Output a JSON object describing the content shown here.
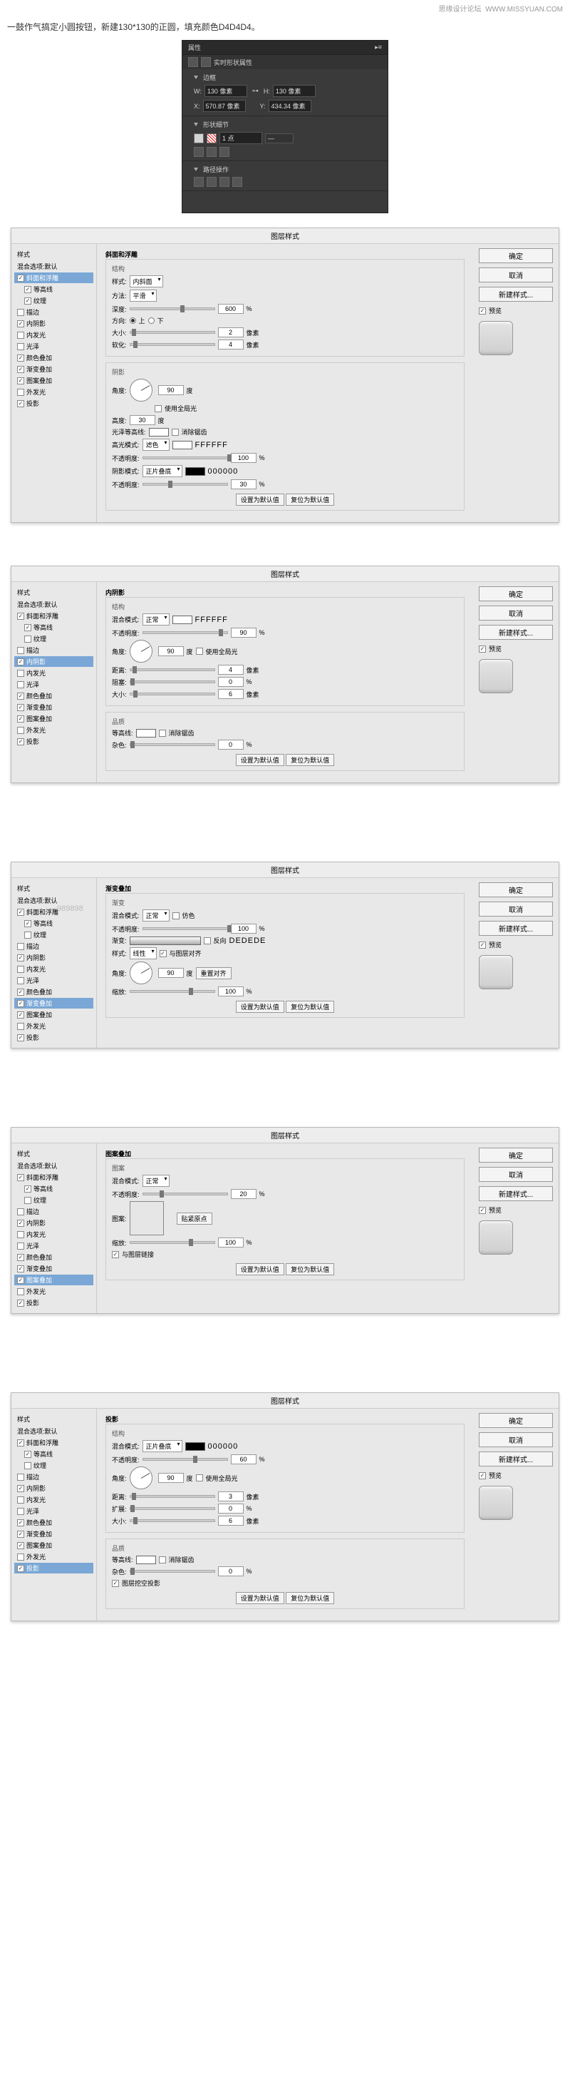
{
  "header": {
    "site": "思缘设计论坛",
    "url": "WWW.MISSYUAN.COM"
  },
  "intro_text": "一鼓作气搞定小圆按钮，新建130*130的正圆，填充颜色D4D4D4。",
  "props": {
    "tab": "属性",
    "live_shape": "实时形状属性",
    "bounding": "边框",
    "w_lbl": "W:",
    "w_val": "130 像素",
    "h_lbl": "H:",
    "h_val": "130 像素",
    "x_lbl": "X:",
    "x_val": "570.87 像素",
    "y_lbl": "Y:",
    "y_val": "434.34 像素",
    "detail": "形状细节",
    "stroke": "1 点",
    "path_ops": "路径操作"
  },
  "common": {
    "dialog_title": "图层样式",
    "styles_head": "样式",
    "blend_defaults": "混合选项:默认",
    "ok": "确定",
    "cancel": "取消",
    "new_style": "新建样式...",
    "preview": "预览",
    "make_default": "设置为默认值",
    "reset_default": "复位为默认值",
    "style_names": [
      "斜面和浮雕",
      "等高线",
      "纹理",
      "描边",
      "内阴影",
      "内发光",
      "光泽",
      "颜色叠加",
      "渐变叠加",
      "图案叠加",
      "外发光",
      "投影"
    ]
  },
  "watermark": "989898",
  "dlg1": {
    "checked": [
      true,
      true,
      true,
      false,
      true,
      false,
      false,
      true,
      true,
      true,
      false,
      true
    ],
    "selected": 0,
    "panel_title": "斜面和浮雕",
    "section1": "结构",
    "style_lbl": "样式:",
    "style_val": "内斜面",
    "method_lbl": "方法:",
    "method_val": "平滑",
    "depth_lbl": "深度:",
    "depth_val": "600",
    "pct": "%",
    "dir_lbl": "方向:",
    "dir_up": "上",
    "dir_down": "下",
    "size_lbl": "大小:",
    "size_val": "2",
    "px": "像素",
    "soften_lbl": "软化:",
    "soften_val": "4",
    "section2": "阴影",
    "angle_lbl": "角度:",
    "angle_val": "90",
    "deg": "度",
    "global_lbl": "使用全局光",
    "alt_lbl": "高度:",
    "alt_val": "30",
    "gloss_lbl": "光泽等高线:",
    "antialias": "消除锯齿",
    "hl_mode_lbl": "高光模式:",
    "hl_mode_val": "滤色",
    "hl_hex": "FFFFFF",
    "opacity_lbl": "不透明度:",
    "hl_op": "100",
    "sh_mode_lbl": "阴影模式:",
    "sh_mode_val": "正片叠底",
    "sh_hex": "000000",
    "sh_op": "30"
  },
  "dlg2": {
    "checked": [
      true,
      true,
      false,
      false,
      true,
      false,
      false,
      true,
      true,
      true,
      false,
      true
    ],
    "selected": 4,
    "panel_title": "内阴影",
    "section1": "结构",
    "blend_lbl": "混合模式:",
    "blend_val": "正常",
    "color_hex": "FFFFFF",
    "opacity_lbl": "不透明度:",
    "opacity_val": "90",
    "pct": "%",
    "angle_lbl": "角度:",
    "angle_val": "90",
    "deg": "度",
    "global": "使用全局光",
    "dist_lbl": "距离:",
    "dist_val": "4",
    "px": "像素",
    "choke_lbl": "阻塞:",
    "choke_val": "0",
    "size_lbl": "大小:",
    "size_val": "6",
    "section2": "品质",
    "contour_lbl": "等高线:",
    "antialias": "消除锯齿",
    "noise_lbl": "杂色:",
    "noise_val": "0"
  },
  "dlg3": {
    "checked": [
      true,
      true,
      false,
      false,
      true,
      false,
      false,
      true,
      true,
      true,
      false,
      true
    ],
    "selected": 8,
    "panel_title": "渐变叠加",
    "section1": "渐变",
    "blend_lbl": "混合模式:",
    "blend_val": "正常",
    "dither": "仿色",
    "opacity_lbl": "不透明度:",
    "opacity_val": "100",
    "pct": "%",
    "grad_lbl": "渐变:",
    "reverse": "反向",
    "grad_hex": "DEDEDE",
    "style_lbl": "样式:",
    "style_val": "线性",
    "align": "与图层对齐",
    "angle_lbl": "角度:",
    "angle_val": "90",
    "deg": "度",
    "reset_align": "重置对齐",
    "scale_lbl": "缩放:",
    "scale_val": "100"
  },
  "dlg4": {
    "checked": [
      true,
      true,
      false,
      false,
      true,
      false,
      false,
      true,
      true,
      true,
      false,
      true
    ],
    "selected": 9,
    "panel_title": "图案叠加",
    "section1": "图案",
    "blend_lbl": "混合模式:",
    "blend_val": "正常",
    "opacity_lbl": "不透明度:",
    "opacity_val": "20",
    "pct": "%",
    "pattern_lbl": "图案:",
    "snap": "贴紧原点",
    "scale_lbl": "缩放:",
    "scale_val": "100",
    "link": "与图层链接"
  },
  "dlg5": {
    "checked": [
      true,
      true,
      false,
      false,
      true,
      false,
      false,
      true,
      true,
      true,
      false,
      true
    ],
    "selected": 11,
    "panel_title": "投影",
    "section1": "结构",
    "blend_lbl": "混合模式:",
    "blend_val": "正片叠底",
    "color_hex": "000000",
    "opacity_lbl": "不透明度:",
    "opacity_val": "60",
    "pct": "%",
    "angle_lbl": "角度:",
    "angle_val": "90",
    "deg": "度",
    "global": "使用全局光",
    "dist_lbl": "距离:",
    "dist_val": "3",
    "px": "像素",
    "spread_lbl": "扩展:",
    "spread_val": "0",
    "size_lbl": "大小:",
    "size_val": "6",
    "section2": "品质",
    "contour_lbl": "等高线:",
    "antialias": "消除锯齿",
    "noise_lbl": "杂色:",
    "noise_val": "0",
    "knockout": "图层挖空投影"
  }
}
